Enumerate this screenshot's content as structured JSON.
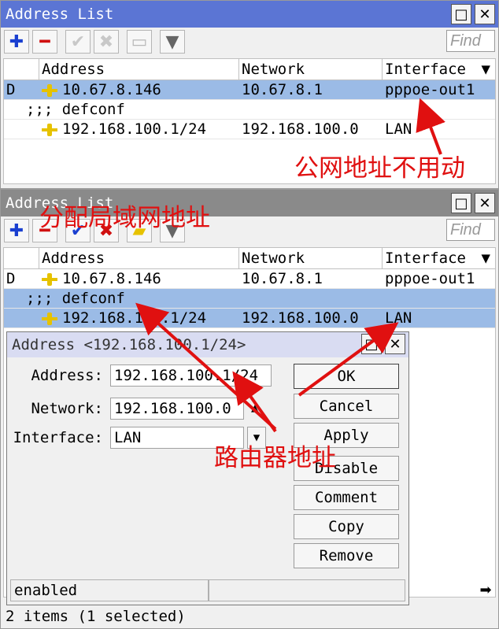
{
  "window1": {
    "title": "Address List",
    "find_placeholder": "Find",
    "columns": [
      "Address",
      "Network",
      "Interface"
    ],
    "rows": [
      {
        "flag": "D",
        "address": "10.67.8.146",
        "network": "10.67.8.1",
        "interface": "pppoe-out1",
        "selected": true
      },
      {
        "comment": ";;; defconf"
      },
      {
        "flag": "",
        "address": "192.168.100.1/24",
        "network": "192.168.100.0",
        "interface": "LAN",
        "selected": false
      }
    ],
    "annotation": "公网地址不用动"
  },
  "window2": {
    "title": "Address List",
    "find_placeholder": "Find",
    "columns": [
      "Address",
      "Network",
      "Interface"
    ],
    "rows": [
      {
        "flag": "D",
        "address": "10.67.8.146",
        "network": "10.67.8.1",
        "interface": "pppoe-out1"
      },
      {
        "comment": ";;; defconf"
      },
      {
        "flag": "",
        "address": "192.168.100.1/24",
        "network": "192.168.100.0",
        "interface": "LAN"
      }
    ],
    "annotation": "分配局域网地址",
    "status": "2 items (1 selected)"
  },
  "dialog": {
    "title": "Address <192.168.100.1/24>",
    "address_label": "Address:",
    "address_value": "192.168.100.1/24",
    "network_label": "Network:",
    "network_value": "192.168.100.0",
    "interface_label": "Interface:",
    "interface_value": "LAN",
    "buttons": [
      "OK",
      "Cancel",
      "Apply",
      "Disable",
      "Comment",
      "Copy",
      "Remove"
    ],
    "status": "enabled",
    "annotation": "路由器地址"
  },
  "colors": {
    "title_active": "#5b75d4",
    "selection": "#9bbbe6",
    "annotation": "#e01010"
  }
}
